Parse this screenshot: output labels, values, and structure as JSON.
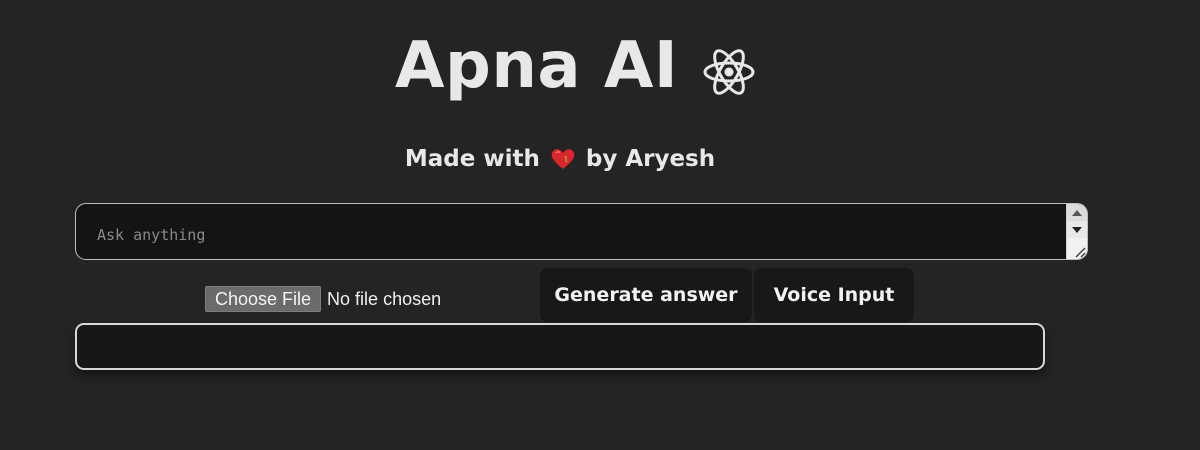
{
  "header": {
    "title": "Apna AI",
    "title_icon": "atom-icon"
  },
  "subtitle": {
    "prefix": "Made with",
    "icon": "heart-icon",
    "suffix": "by Aryesh"
  },
  "prompt": {
    "placeholder": "Ask anything",
    "value": ""
  },
  "file_upload": {
    "button_label": "Choose File",
    "status": "No file chosen"
  },
  "actions": {
    "generate_label": "Generate answer",
    "voice_label": "Voice Input"
  },
  "answer": {
    "text": ""
  },
  "colors": {
    "background": "#242424",
    "input_background": "#141414",
    "button_background": "#181818",
    "heart": "#d6282c"
  }
}
